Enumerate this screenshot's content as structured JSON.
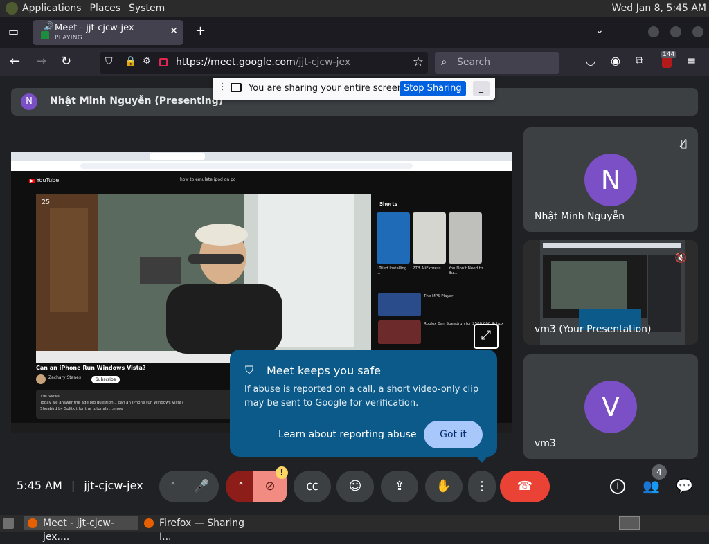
{
  "gnome_panel": {
    "menus": [
      "Applications",
      "Places",
      "System"
    ],
    "clock": "Wed Jan  8,  5:45 AM"
  },
  "browser": {
    "tab": {
      "title": "Meet - jjt-cjcw-jex",
      "subtitle": "PLAYING"
    },
    "url_host": "https://meet.google.com",
    "url_path": "/jjt-cjcw-jex",
    "search_placeholder": "Search",
    "badge_count": "144"
  },
  "share_banner": {
    "message": "You are sharing your entire screen.",
    "stop_label": "Stop Sharing"
  },
  "meet": {
    "presenter_initial": "N",
    "presenter_label": "Nhật Minh Nguyễn (Presenting)",
    "time": "5:45 AM",
    "meeting_code": "jjt-cjcw-jex",
    "participant_count": "4",
    "tiles": [
      {
        "initial": "N",
        "name": "Nhật Minh Nguyễn",
        "color": "#7b4fc6"
      },
      {
        "name": "vm3 (Your Presentation)"
      },
      {
        "initial": "V",
        "name": "vm3",
        "color": "#7b4fc6"
      }
    ]
  },
  "youtube": {
    "logo": "YouTube",
    "query": "how to emulate ipod on pc",
    "timer": "25",
    "video_title": "Can an iPhone Run Windows Vista?",
    "channel": "Zachary Stanes",
    "subscribe": "Subscribe",
    "desc_line1": "19K views",
    "desc_line2": "Today we answer the age old question... can an iPhone run Windows Vista?",
    "desc_line3": "Sheabird by Splitkit for the tutorials ...more",
    "shorts": "Shorts",
    "short_labels": [
      "I Tried Installing ...",
      "2TB AliExpress ...",
      "You Don't Need to Bu..."
    ],
    "rec_labels": [
      "The MP5 Player",
      "Roblox Ban Speedrun for 2500,000 Robux"
    ]
  },
  "popup": {
    "title": "Meet keeps you safe",
    "body": "If abuse is reported on a call, a short video-only clip may be sent to Google for verification.",
    "learn": "Learn about reporting abuse",
    "got_it": "Got it"
  },
  "taskbar": {
    "items": [
      "Meet - jjt-cjcw-jex....",
      "Firefox — Sharing I..."
    ]
  },
  "colors": {
    "end_call": "#ea4335",
    "camera_off": "#f28b82",
    "accent": "#a8c7fa"
  }
}
